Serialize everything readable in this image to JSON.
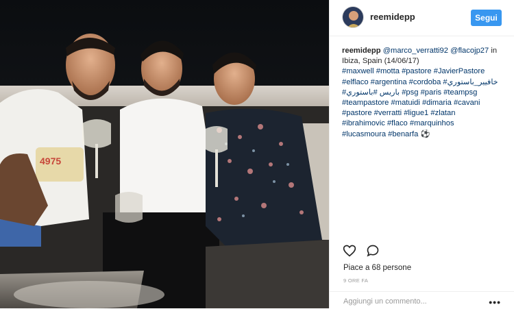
{
  "post": {
    "username": "reemidepp",
    "follow_label": "Segui",
    "caption_parts": [
      {
        "text": "reemidepp",
        "type": "user"
      },
      {
        "text": " ",
        "type": "text"
      },
      {
        "text": "@marco_verratti92",
        "type": "mention"
      },
      {
        "text": " ",
        "type": "text"
      },
      {
        "text": "@flacojp27",
        "type": "mention"
      },
      {
        "text": " in Ibiza, Spain (14/06/17)",
        "type": "text"
      },
      {
        "text": "\n",
        "type": "text"
      },
      {
        "text": "#maxwell",
        "type": "tag"
      },
      {
        "text": " ",
        "type": "text"
      },
      {
        "text": "#motta",
        "type": "tag"
      },
      {
        "text": " ",
        "type": "text"
      },
      {
        "text": "#pastore",
        "type": "tag"
      },
      {
        "text": " ",
        "type": "text"
      },
      {
        "text": "#JavierPastore",
        "type": "tag"
      },
      {
        "text": "\n",
        "type": "text"
      },
      {
        "text": "#elflaco",
        "type": "tag"
      },
      {
        "text": " ",
        "type": "text"
      },
      {
        "text": "#argentina",
        "type": "tag"
      },
      {
        "text": " ",
        "type": "text"
      },
      {
        "text": "#cordoba",
        "type": "tag"
      },
      {
        "text": " ",
        "type": "text"
      },
      {
        "text": "#خافيير_باستوري",
        "type": "tag"
      },
      {
        "text": "\n",
        "type": "text"
      },
      {
        "text": "#باريس",
        "type": "tag"
      },
      {
        "text": "  ",
        "type": "text"
      },
      {
        "text": "#باستوري",
        "type": "tag"
      },
      {
        "text": "  ",
        "type": "text"
      },
      {
        "text": "#psg",
        "type": "tag"
      },
      {
        "text": " ",
        "type": "text"
      },
      {
        "text": "#paris",
        "type": "tag"
      },
      {
        "text": " ",
        "type": "text"
      },
      {
        "text": "#teampsg",
        "type": "tag"
      },
      {
        "text": "\n",
        "type": "text"
      },
      {
        "text": "#teampastore",
        "type": "tag"
      },
      {
        "text": " ",
        "type": "text"
      },
      {
        "text": "#matuidi",
        "type": "tag"
      },
      {
        "text": " ",
        "type": "text"
      },
      {
        "text": "#dimaria",
        "type": "tag"
      },
      {
        "text": " ",
        "type": "text"
      },
      {
        "text": "#cavani",
        "type": "tag"
      },
      {
        "text": "\n",
        "type": "text"
      },
      {
        "text": "#pastore",
        "type": "tag"
      },
      {
        "text": " ",
        "type": "text"
      },
      {
        "text": "#verratti",
        "type": "tag"
      },
      {
        "text": " ",
        "type": "text"
      },
      {
        "text": "#ligue1",
        "type": "tag"
      },
      {
        "text": " ",
        "type": "text"
      },
      {
        "text": "#zlatan",
        "type": "tag"
      },
      {
        "text": "\n",
        "type": "text"
      },
      {
        "text": "#ibrahimovic",
        "type": "tag"
      },
      {
        "text": " ",
        "type": "text"
      },
      {
        "text": "#flaco",
        "type": "tag"
      },
      {
        "text": " ",
        "type": "text"
      },
      {
        "text": "#marquinhos",
        "type": "tag"
      },
      {
        "text": "\n",
        "type": "text"
      },
      {
        "text": "#lucasmoura",
        "type": "tag"
      },
      {
        "text": " ",
        "type": "text"
      },
      {
        "text": "#benarfa",
        "type": "tag"
      },
      {
        "text": " ",
        "type": "text"
      },
      {
        "text": "⚽",
        "type": "emoji"
      }
    ],
    "likes_text": "Piace a 68 persone",
    "time_text": "9 ORE FA",
    "comment_placeholder": "Aggiungi un commento...",
    "more_label": "•••"
  },
  "icons": {
    "like": "heart-icon",
    "comment": "comment-bubble-icon"
  },
  "colors": {
    "follow_button": "#3897f0",
    "link": "#003569",
    "text": "#262626",
    "muted": "#999999"
  }
}
